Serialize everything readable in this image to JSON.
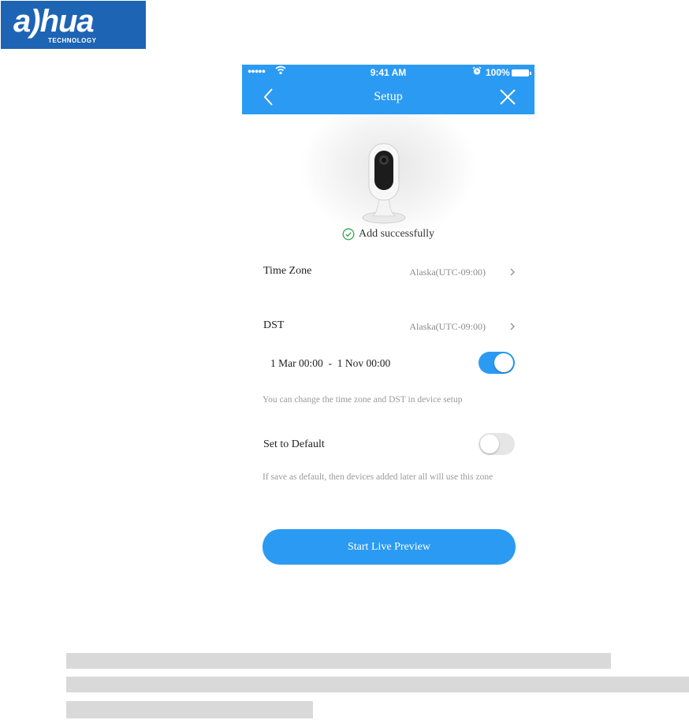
{
  "logo": {
    "brand": "a)hua",
    "subtitle": "TECHNOLOGY"
  },
  "status_bar": {
    "signal": "●●●●●",
    "time": "9:41 AM",
    "battery": "100%"
  },
  "navbar": {
    "title": "Setup"
  },
  "success_message": "Add successfully",
  "time_zone": {
    "label": "Time Zone",
    "value": "Alaska(UTC-09:00)"
  },
  "dst": {
    "label": "DST",
    "value": "Alaska(UTC-09:00)",
    "range": "1 Mar 00:00  -  1 Nov 00:00",
    "enabled": true
  },
  "dst_hint": "You can change the time zone and DST in device setup",
  "default": {
    "label": "Set to Default",
    "enabled": false,
    "hint": "If save as default, then devices added later all will use this zone"
  },
  "cta_label": "Start Live Preview",
  "colors": {
    "accent": "#2b9af3",
    "brand": "#1e64b4"
  }
}
